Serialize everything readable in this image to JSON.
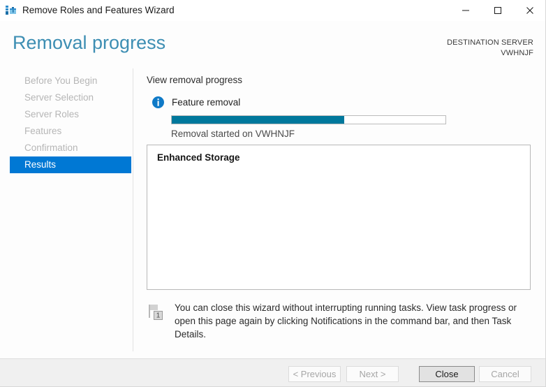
{
  "window": {
    "title": "Remove Roles and Features Wizard",
    "icon": "server-manager-toolbox-icon",
    "controls": {
      "minimize": "minimize-icon",
      "maximize": "maximize-icon",
      "close": "close-icon"
    }
  },
  "header": {
    "page_title": "Removal progress",
    "destination_label": "DESTINATION SERVER",
    "destination_server": "VWHNJF",
    "title_color": "#3d8eb3"
  },
  "sidebar": {
    "items": [
      {
        "label": "Before You Begin",
        "selected": false
      },
      {
        "label": "Server Selection",
        "selected": false
      },
      {
        "label": "Server Roles",
        "selected": false
      },
      {
        "label": "Features",
        "selected": false
      },
      {
        "label": "Confirmation",
        "selected": false
      },
      {
        "label": "Results",
        "selected": true
      }
    ],
    "selected_color": "#0078d4"
  },
  "main": {
    "section_heading": "View removal progress",
    "task": {
      "icon": "info-icon",
      "label": "Feature removal",
      "status_text": "Removal started on VWHNJF"
    },
    "progress": {
      "percent": 63,
      "fill_color": "#00789c",
      "track_color": "#ffffff"
    },
    "results_box": {
      "items": [
        "Enhanced Storage"
      ]
    },
    "note": {
      "icon": "notification-flag-icon",
      "badge_count": "1",
      "text": "You can close this wizard without interrupting running tasks. View task progress or open this page again by clicking Notifications in the command bar, and then Task Details."
    }
  },
  "footer": {
    "buttons": [
      {
        "id": "previous",
        "label": "< Previous",
        "enabled": false
      },
      {
        "id": "next",
        "label": "Next >",
        "enabled": false
      },
      {
        "id": "close",
        "label": "Close",
        "enabled": true
      },
      {
        "id": "cancel",
        "label": "Cancel",
        "enabled": false
      }
    ]
  }
}
